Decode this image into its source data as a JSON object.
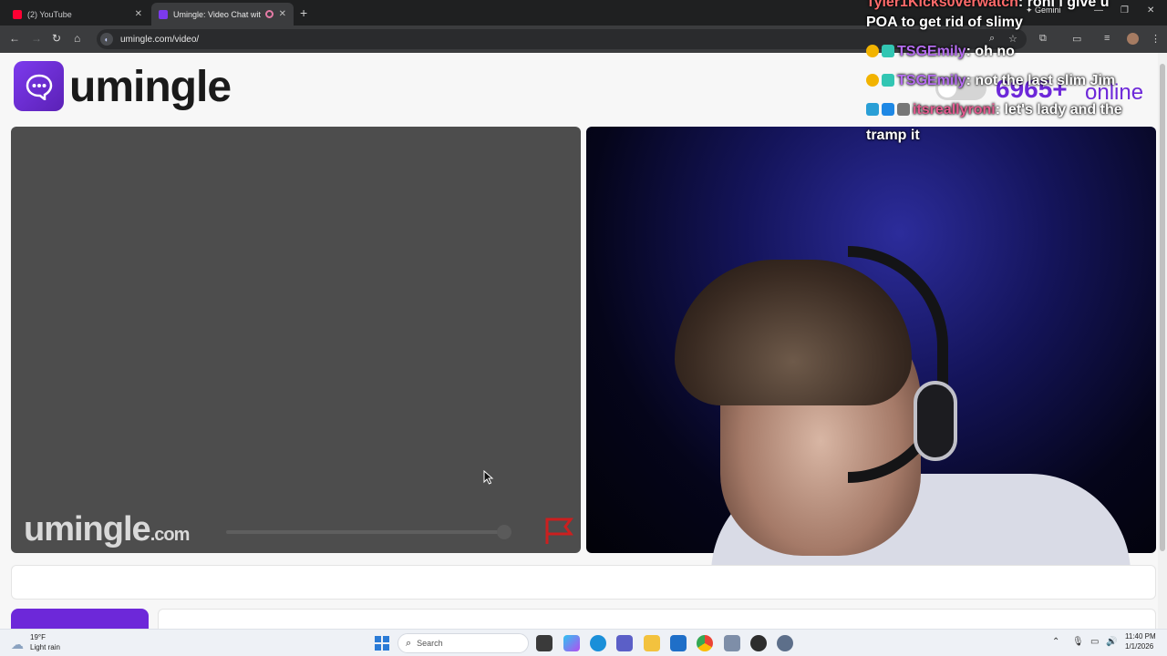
{
  "browser": {
    "tabs": [
      {
        "title": "(2) YouTube",
        "active": false
      },
      {
        "title": "Umingle: Video Chat with S",
        "active": true
      }
    ],
    "gemini_label": "Gemini",
    "url": "umingle.com/video/"
  },
  "page": {
    "logo_text": "umingle",
    "watermark": "umingle",
    "watermark_suffix": ".com",
    "online_count": "6965+",
    "online_label": "online",
    "accent_color": "#6d28d9"
  },
  "stream_chat": [
    {
      "user": "Tyler1Kicks0verwatch",
      "message": ": roni i give u"
    },
    {
      "user": "",
      "message": "POA to get rid of slimy"
    },
    {
      "user": "TSGEmily",
      "message": ": oh no"
    },
    {
      "user": "TSGEmily",
      "message": ": not the last slim Jim"
    },
    {
      "user": "itsreallyroni",
      "message": ": let's lady and the"
    },
    {
      "user": "",
      "message": "tramp it"
    }
  ],
  "taskbar": {
    "weather_temp": "19°F",
    "weather_desc": "Light rain",
    "search_label": "Search",
    "time": "11:40 PM",
    "date": "1/1/2026"
  }
}
